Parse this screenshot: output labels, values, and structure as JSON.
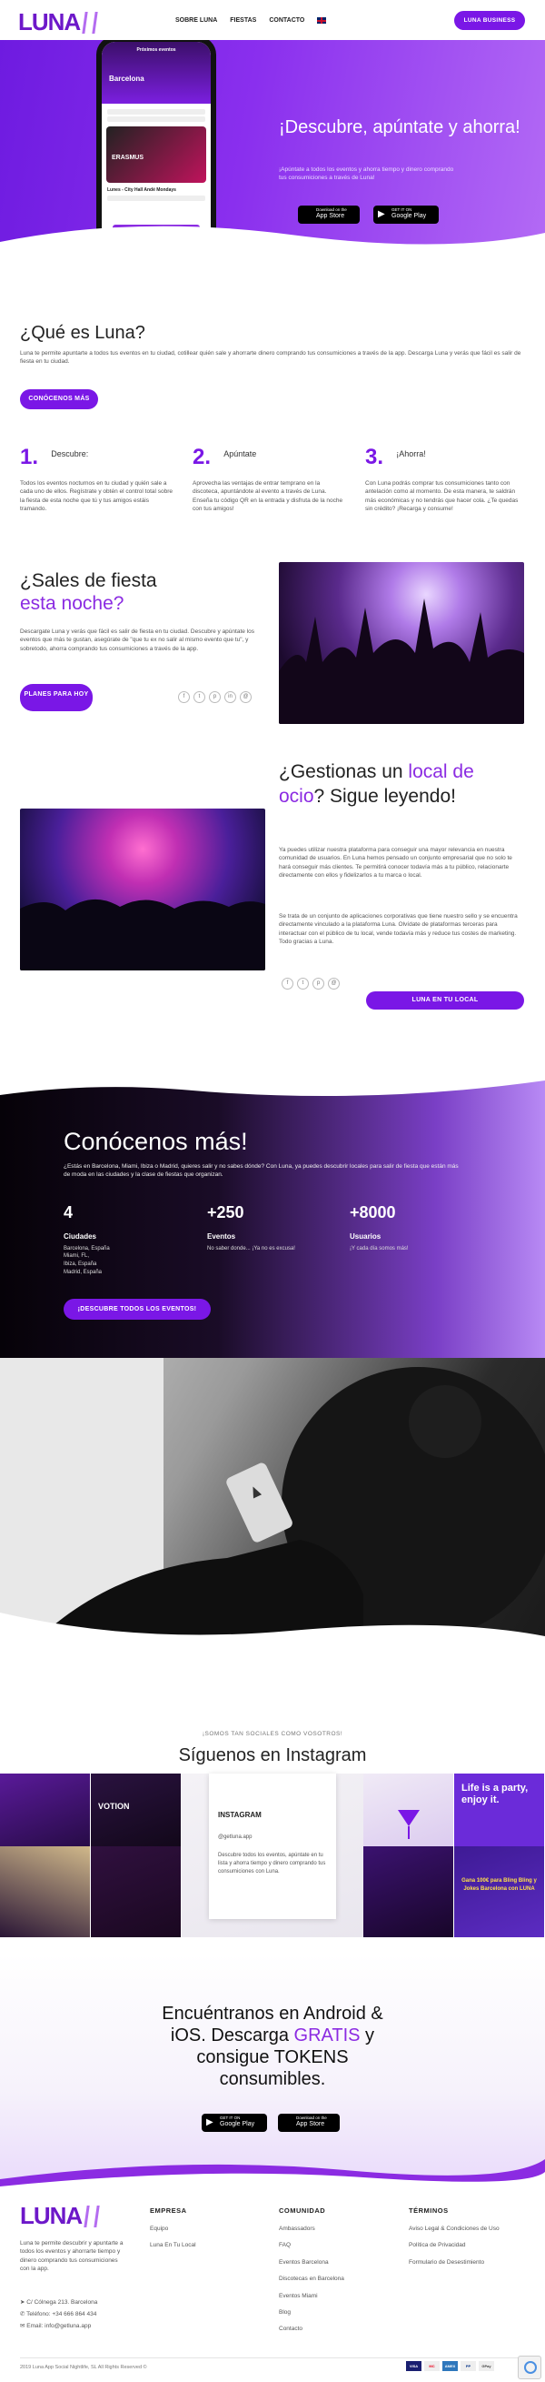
{
  "header": {
    "logo": "LUNA",
    "nav": [
      "SOBRE LUNA",
      "FIESTAS",
      "CONTACTO"
    ],
    "business_button": "LUNA BUSINESS"
  },
  "hero": {
    "title": "¡Descubre, apúntate y ahorra!",
    "subtitle": "¡Apúntate a todos los eventos y ahorra tiempo y dinero comprando tus consumiciones a través de Luna!",
    "app_store": {
      "small": "Download on the",
      "big": "App Store"
    },
    "google_play": {
      "small": "GET IT ON",
      "big": "Google Play"
    },
    "phone": {
      "header": "Próximos eventos",
      "city": "Barcelona",
      "card_title": "ERASMUS",
      "event_name": "Lunes - City Hall Andé Mondays"
    }
  },
  "que": {
    "title": "¿Qué es Luna?",
    "body": "Luna te permite apuntarte a todos tus eventos en tu ciudad, cotillear quién sale y ahorrarte dinero comprando tus consumiciones a través de la app. Descarga Luna y verás que fácil es salir de fiesta en tu ciudad.",
    "button": "CONÓCENOS MÁS",
    "steps": [
      {
        "n": "1.",
        "t": "Descubre:",
        "d": "Todos los eventos nocturnos en tu ciudad y quién sale a cada uno de ellos. Regístrate y obtén el control total sobre la fiesta de esta noche que tú y tus amigos estáis tramando."
      },
      {
        "n": "2.",
        "t": "Apúntate",
        "d": "Aprovecha las ventajas de entrar temprano en la discoteca, apuntándote al evento a través de Luna. Enseña tu código QR en la entrada y disfruta de la noche con tus amigos!"
      },
      {
        "n": "3.",
        "t": "¡Ahorra!",
        "d": "Con Luna podrás comprar tus consumiciones tanto con antelación como al momento. De esta manera, te saldrán más económicas y no tendrás que hacer cola. ¿Te quedas sin crédito? ¡Recarga y consume!"
      }
    ]
  },
  "sales": {
    "title_a": "¿Sales de fiesta",
    "title_b": "esta noche?",
    "body": "Descargate Luna y verás que fácil es salir de fiesta en tu ciudad. Descubre y apúntate los eventos que más te gustan, asegúrate de \"que tu ex no salir al mismo evento que tu\", y sobretodo, ahorra comprando tus consumiciones a través de la app.",
    "button": "PLANES PARA HOY"
  },
  "local": {
    "title_a": "¿Gestionas un ",
    "title_hl": "local de ocio",
    "title_b": "? Sigue leyendo!",
    "p1": "Ya puedes utilizar nuestra plataforma para conseguir una mayor relevancia en nuestra comunidad de usuarios. En Luna hemos pensado un conjunto empresarial que no solo te hará conseguir más clientes. Te permitirá conocer todavía más a tu público, relacionarte directamente con ellos y fidelizarlos a tu marca o local.",
    "p2": "Se trata de un conjunto de aplicaciones corporativas que tiene nuestro sello y se encuentra directamente vinculado a la plataforma Luna. Olvídate de plataformas terceras para interactuar con el público de tu local, vende todavía más y reduce tus costes de marketing. Todo gracias a Luna.",
    "button": "LUNA EN TU LOCAL"
  },
  "stats": {
    "title": "Conócenos más!",
    "body": "¿Estás en Barcelona, Miami, Ibiza o Madrid, quieres salir y no sabes dónde? Con Luna, ya puedes descubrir locales para salir de fiesta que están más de moda en las ciudades y la clase de fiestas que organizan.",
    "items": [
      {
        "n": "4",
        "l": "Ciudades",
        "d": "Barcelona, España\nMiami, FL,\nIbiza, España\nMadrid, España"
      },
      {
        "n": "+250",
        "l": "Eventos",
        "d": "No saber donde... ¡Ya no es excusa!"
      },
      {
        "n": "+8000",
        "l": "Usuarios",
        "d": "¡Y cada día somos más!"
      }
    ],
    "button": "¡DESCUBRE TODOS LOS EVENTOS!"
  },
  "instagram": {
    "kicker": "¡SOMOS TAN SOCIALES COMO VOSOTROS!",
    "title": "Síguenos en Instagram",
    "card_title": "INSTAGRAM",
    "card_handle": "@getluna.app",
    "card_body": "Descubre todos los eventos, apúntate en tu lista y ahorra tiempo y dinero comprando tus consumiciones con Luna.",
    "tile_text_a": "Life is a party, enjoy it.",
    "tile_text_b": "Gana 100€ para Bling Bling y Jokes Barcelona con LUNA"
  },
  "download": {
    "line1": "Encuéntranos en Android &",
    "line2a": "iOS. Descarga ",
    "line2b": "GRATIS",
    "line2c": " y",
    "line3": "consigue TOKENS",
    "line4": "consumibles."
  },
  "footer": {
    "about": "Luna te permite descubrir y apuntarte a todos los eventos y ahorrarte tiempo y dinero comprando tus consumiciones con la app.",
    "address": "C/ Cólnega 213. Barcelona",
    "phone": "Teléfono: +34 666 864 434",
    "email": "Email: info@getluna.app",
    "cols": [
      {
        "h": "EMPRESA",
        "items": [
          "Equipo",
          "Luna En Tu Local"
        ]
      },
      {
        "h": "COMUNIDAD",
        "items": [
          "Ambassadors",
          "FAQ",
          "Eventos Barcelona",
          "Discotecas en Barcelona",
          "Eventos Miami",
          "Blog",
          "Contacto"
        ]
      },
      {
        "h": "TÉRMINOS",
        "items": [
          "Aviso Legal & Condiciones de Uso",
          "Política de Privacidad",
          "Formulario de Desestimiento"
        ]
      }
    ],
    "copyright": "2019 Luna App Social Nightlife, SL All Rights Reserved ©",
    "payments": [
      "VISA",
      "MC",
      "AMEX",
      "PP",
      "GPay"
    ]
  },
  "colors": {
    "accent": "#7a17e6",
    "hero": "#8a2fee",
    "dark": "#0b0410"
  }
}
